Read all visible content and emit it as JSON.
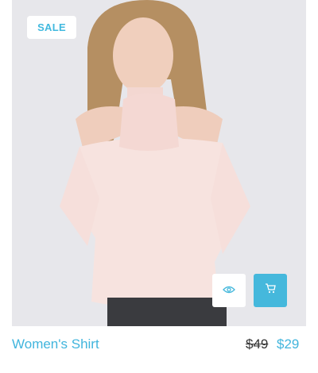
{
  "product": {
    "badge": "SALE",
    "name": "Women's Shirt",
    "old_price": "$49",
    "new_price": "$29"
  },
  "actions": {
    "quick_view_icon": "eye-icon",
    "add_to_cart_icon": "cart-icon"
  },
  "colors": {
    "accent": "#41b5dd",
    "badge_text": "#41b9df",
    "cart_button": "#45b8dc",
    "old_price": "#333333"
  }
}
